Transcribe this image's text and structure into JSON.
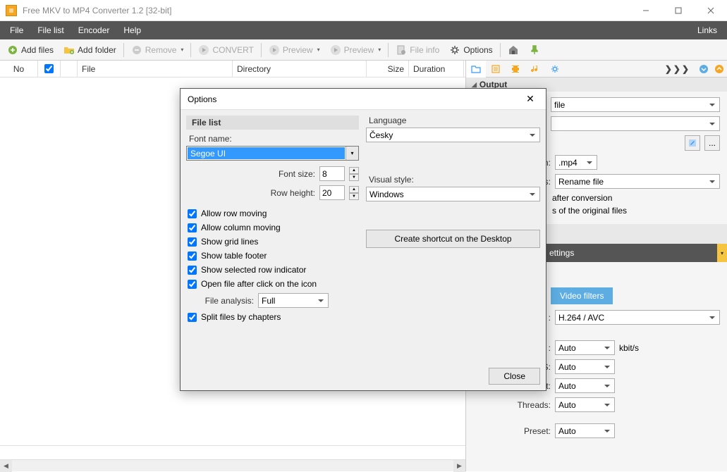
{
  "window": {
    "title": "Free MKV to MP4 Converter 1.2  [32-bit]"
  },
  "menubar": {
    "items": [
      "File",
      "File list",
      "Encoder",
      "Help"
    ],
    "links": "Links"
  },
  "toolbar": {
    "add_files": "Add files",
    "add_folder": "Add folder",
    "remove": "Remove",
    "convert": "CONVERT",
    "preview1": "Preview",
    "preview2": "Preview",
    "file_info": "File info",
    "options": "Options"
  },
  "columns": {
    "no": "No",
    "file": "File",
    "directory": "Directory",
    "size": "Size",
    "duration": "Duration"
  },
  "sidepanel": {
    "chevrons": "❯❯❯",
    "output_header": "Output",
    "dest_label": "file",
    "ext_label": "le extension:",
    "ext_value": ".mp4",
    "exists_label": "e exists:",
    "exists_value": "Rename file",
    "after_conv": "after conversion",
    "of_original": "s of the original files",
    "settings_btn": "ettings",
    "tab_video_filters": "Video filters",
    "codec_suffix": ":",
    "codec_value": "H.264 / AVC",
    "bitrate_suffix": ":",
    "bitrate_value": "Auto",
    "bitrate_unit": "kbit/s",
    "fps_label": "FPS:",
    "fps_value": "Auto",
    "aspect_label": "Aspect:",
    "aspect_value": "Auto",
    "threads_label": "Threads:",
    "threads_value": "Auto",
    "preset_label": "Preset:",
    "preset_value": "Auto"
  },
  "dialog": {
    "title": "Options",
    "filelist_header": "File list",
    "font_name_label": "Font name:",
    "font_name_value": "Segoe UI",
    "font_size_label": "Font size:",
    "font_size_value": "8",
    "row_height_label": "Row height:",
    "row_height_value": "20",
    "allow_row_moving": "Allow row moving",
    "allow_column_moving": "Allow column moving",
    "show_grid_lines": "Show grid lines",
    "show_table_footer": "Show table footer",
    "show_selected_row": "Show selected row indicator",
    "open_file_after": "Open file after click on the icon",
    "file_analysis_label": "File analysis:",
    "file_analysis_value": "Full",
    "split_files": "Split files by chapters",
    "language_label": "Language",
    "language_value": "Česky",
    "visual_style_label": "Visual style:",
    "visual_style_value": "Windows",
    "create_shortcut": "Create shortcut on the Desktop",
    "close": "Close"
  }
}
